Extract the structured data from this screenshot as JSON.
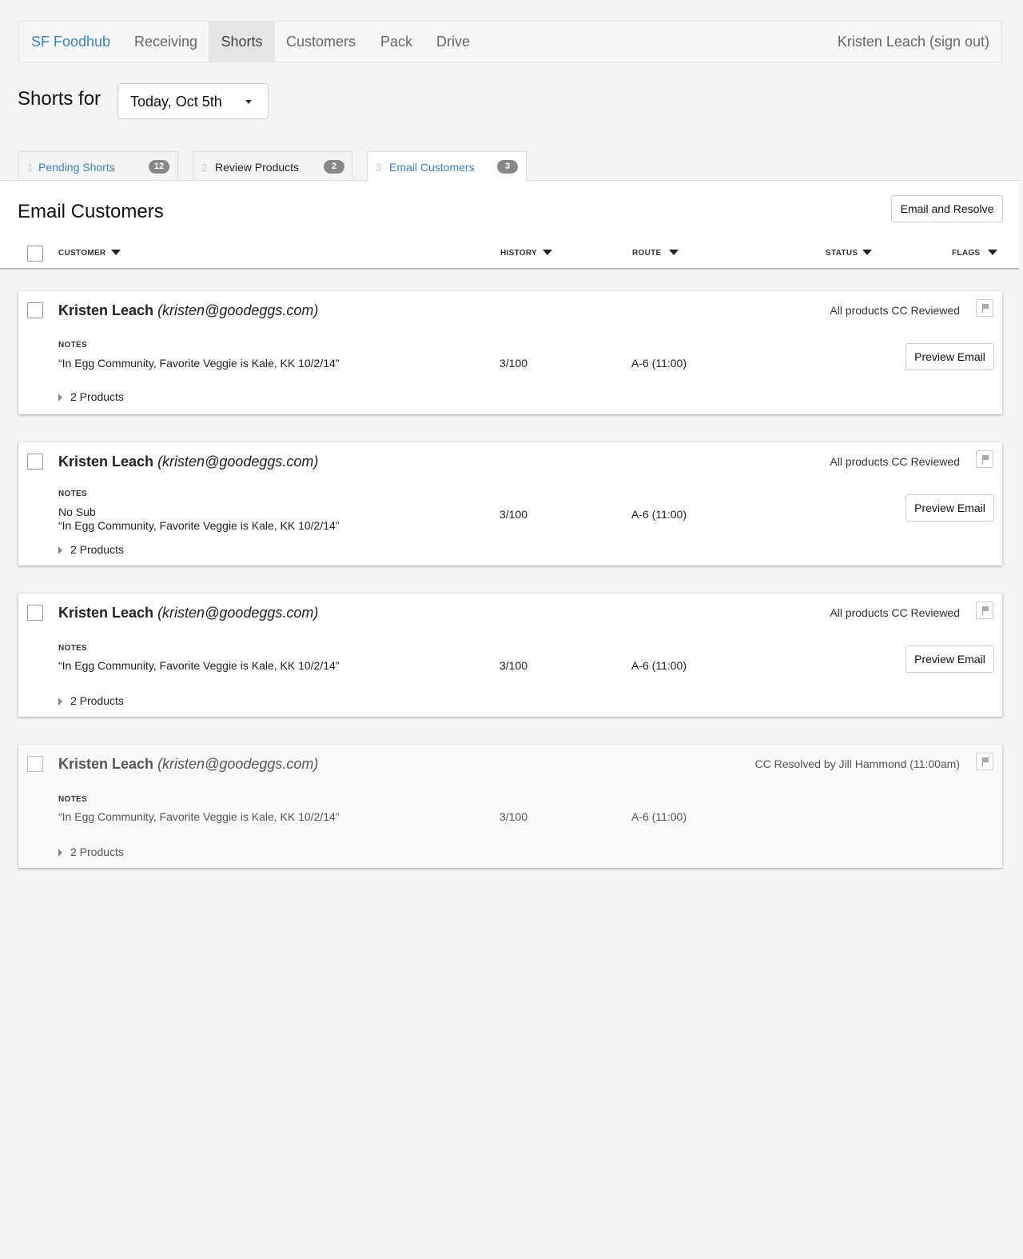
{
  "nav": {
    "brand": "SF Foodhub",
    "items": [
      "Receiving",
      "Shorts",
      "Customers",
      "Pack",
      "Drive"
    ],
    "active": "Shorts",
    "user": "Kristen Leach (sign out)"
  },
  "shorts_for": {
    "label": "Shorts for",
    "date": "Today, Oct 5th"
  },
  "tabs": [
    {
      "num": "1",
      "label": "Pending Shorts",
      "count": "12"
    },
    {
      "num": "2",
      "label": "Review Products",
      "count": "2"
    },
    {
      "num": "3",
      "label": "Email Customers",
      "count": "3"
    }
  ],
  "panel": {
    "title": "Email Customers",
    "action": "Email and Resolve",
    "columns": {
      "customer": "CUSTOMER",
      "history": "HISTORY",
      "route": "ROUTE",
      "status": "STATUS",
      "flags": "FLAGS"
    }
  },
  "notes_label": "NOTES",
  "customers": [
    {
      "name": "Kristen Leach",
      "email": "(kristen@goodeggs.com)",
      "status": "All products CC Reviewed",
      "note_line1": "",
      "note_line2": "“In Egg Community, Favorite Veggie is Kale, KK 10/2/14”",
      "history": "3/100",
      "route": "A-6 (11:00)",
      "products": "2 Products",
      "action": "Preview Email"
    },
    {
      "name": "Kristen Leach",
      "email": "(kristen@goodeggs.com)",
      "status": "All products CC Reviewed",
      "note_line1": "No Sub",
      "note_line2": "“In Egg Community, Favorite Veggie is Kale, KK 10/2/14”",
      "history": "3/100",
      "route": "A-6 (11:00)",
      "products": "2 Products",
      "action": "Preview Email"
    },
    {
      "name": "Kristen Leach",
      "email": "(kristen@goodeggs.com)",
      "status": "All products CC Reviewed",
      "note_line1": "",
      "note_line2": "“In Egg Community, Favorite Veggie is Kale, KK 10/2/14”",
      "history": "3/100",
      "route": "A-6 (11:00)",
      "products": "2 Products",
      "action": "Preview Email"
    },
    {
      "name": "Kristen Leach",
      "email": "(kristen@goodeggs.com)",
      "status": "CC Resolved by Jill Hammond (11:00am)",
      "note_line1": "",
      "note_line2": "“In Egg Community, Favorite Veggie is Kale, KK 10/2/14”",
      "history": "3/100",
      "route": "A-6 (11:00)",
      "products": "2 Products",
      "action": ""
    }
  ],
  "colors": {
    "brand": "#3b83c0",
    "badge": "#888888",
    "page_bg": "#f4f4f4"
  }
}
